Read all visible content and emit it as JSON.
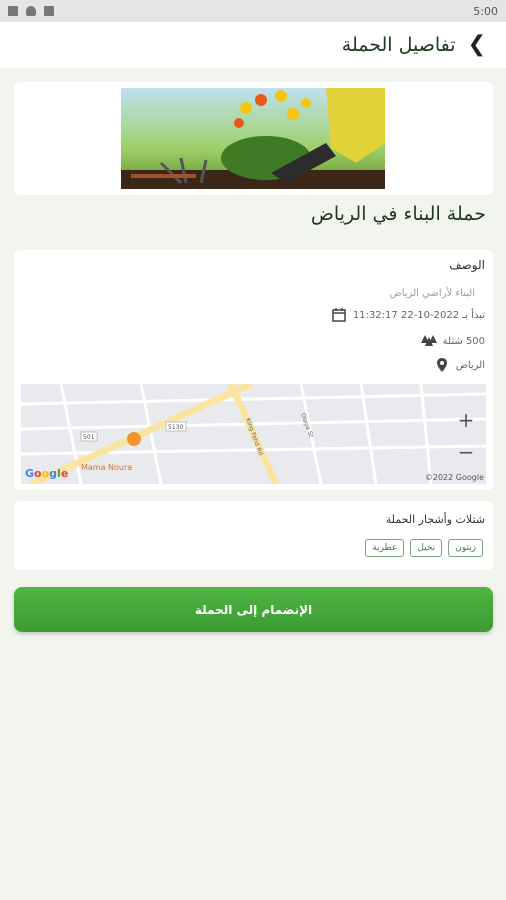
{
  "status": {
    "time": "5:00"
  },
  "header": {
    "title": "تفاصيل الحملة",
    "back_icon": "chevron-left-icon"
  },
  "campaign": {
    "name": "حملة البناء في الرياض",
    "section_label": "الوصف",
    "description": "البناء لأراضي الرياض",
    "date": "تبدأ بـ 2022-10-22 11:32:17",
    "seedlings": "500 شتلة",
    "location": "الرياض"
  },
  "map": {
    "street_labels": [
      "King Fahd Rd",
      "Olaya St",
      "Mama Noura"
    ],
    "route_labels": [
      "5130",
      "501"
    ],
    "copyright": "©2022 Google",
    "logo": "Google"
  },
  "plants": {
    "title": "شتلات وأشجار الحملة",
    "chips": [
      "زيتون",
      "نخيل",
      "عطرية"
    ]
  },
  "join_button": {
    "label": "الإنضمام إلى الحملة"
  },
  "colors": {
    "accent": "#3fa436",
    "title_dark": "#1e3a1f",
    "background": "#f1f5ee"
  }
}
